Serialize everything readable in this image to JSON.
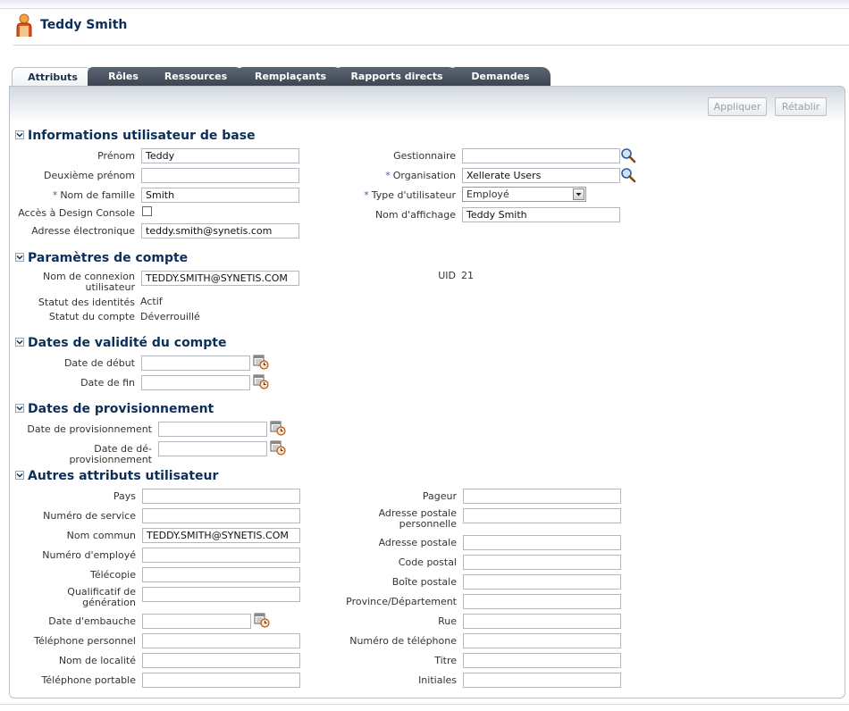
{
  "header": {
    "title": "Teddy Smith",
    "icon": "person-icon"
  },
  "tabs": [
    {
      "label": "Attributs",
      "active": true
    },
    {
      "label": "Rôles"
    },
    {
      "label": "Ressources"
    },
    {
      "label": "Remplaçants"
    },
    {
      "label": "Rapports directs"
    },
    {
      "label": "Demandes"
    }
  ],
  "toolbar": {
    "apply_label": "Appliquer",
    "reset_label": "Rétablir"
  },
  "required_marker": "*",
  "sections": {
    "basic": {
      "title": "Informations utilisateur de base",
      "first_name": {
        "label": "Prénom",
        "value": "Teddy"
      },
      "middle_name": {
        "label": "Deuxième prénom",
        "value": ""
      },
      "last_name": {
        "label": "Nom de famille",
        "value": "Smith",
        "required": true
      },
      "design_console": {
        "label": "Accès à Design Console",
        "checked": false
      },
      "email": {
        "label": "Adresse électronique",
        "value": "teddy.smith@synetis.com"
      },
      "manager": {
        "label": "Gestionnaire",
        "value": ""
      },
      "organization": {
        "label": "Organisation",
        "value": "Xellerate Users",
        "required": true
      },
      "user_type": {
        "label": "Type d'utilisateur",
        "value": "Employé",
        "required": true
      },
      "display_name": {
        "label": "Nom d'affichage",
        "value": "Teddy Smith"
      }
    },
    "account": {
      "title": "Paramètres de compte",
      "login_label_1": "Nom de connexion",
      "login_label_2": "utilisateur",
      "login_value": "TEDDY.SMITH@SYNETIS.COM",
      "identity_status": {
        "label": "Statut des identités",
        "value": "Actif"
      },
      "account_status": {
        "label": "Statut du compte",
        "value": "Déverrouillé"
      },
      "uid": {
        "label": "UID",
        "value": "21"
      }
    },
    "validity": {
      "title": "Dates de validité du compte",
      "start": {
        "label": "Date de début",
        "value": ""
      },
      "end": {
        "label": "Date de fin",
        "value": ""
      }
    },
    "provisioning": {
      "title": "Dates de provisionnement",
      "prov": {
        "label": "Date de provisionnement",
        "value": ""
      },
      "deprov": {
        "label": "Date de dé-provisionnement",
        "value": ""
      }
    },
    "other": {
      "title": "Autres attributs utilisateur",
      "left": [
        {
          "label": "Pays",
          "value": ""
        },
        {
          "label": "Numéro de service",
          "value": ""
        },
        {
          "label": "Nom commun",
          "value": "TEDDY.SMITH@SYNETIS.COM"
        },
        {
          "label": "Numéro d'employé",
          "value": ""
        },
        {
          "label": "Télécopie",
          "value": ""
        },
        {
          "label": "Qualificatif de\ngénération",
          "value": ""
        },
        {
          "label": "Date d'embauche",
          "value": ""
        },
        {
          "label": "Téléphone personnel",
          "value": ""
        },
        {
          "label": "Nom de localité",
          "value": ""
        },
        {
          "label": "Téléphone portable",
          "value": ""
        }
      ],
      "right": [
        {
          "label": "Pageur",
          "value": ""
        },
        {
          "label": "Adresse postale\npersonnelle",
          "value": ""
        },
        {
          "label": "Adresse postale",
          "value": ""
        },
        {
          "label": "Code postal",
          "value": ""
        },
        {
          "label": "Boîte postale",
          "value": ""
        },
        {
          "label": "Province/Département",
          "value": ""
        },
        {
          "label": "Rue",
          "value": ""
        },
        {
          "label": "Numéro de téléphone",
          "value": ""
        },
        {
          "label": "Titre",
          "value": ""
        },
        {
          "label": "Initiales",
          "value": ""
        }
      ]
    }
  },
  "icons": {
    "search": "magnifier-icon",
    "calendar": "calendar-icon",
    "collapse": "collapse-chevron-icon"
  }
}
